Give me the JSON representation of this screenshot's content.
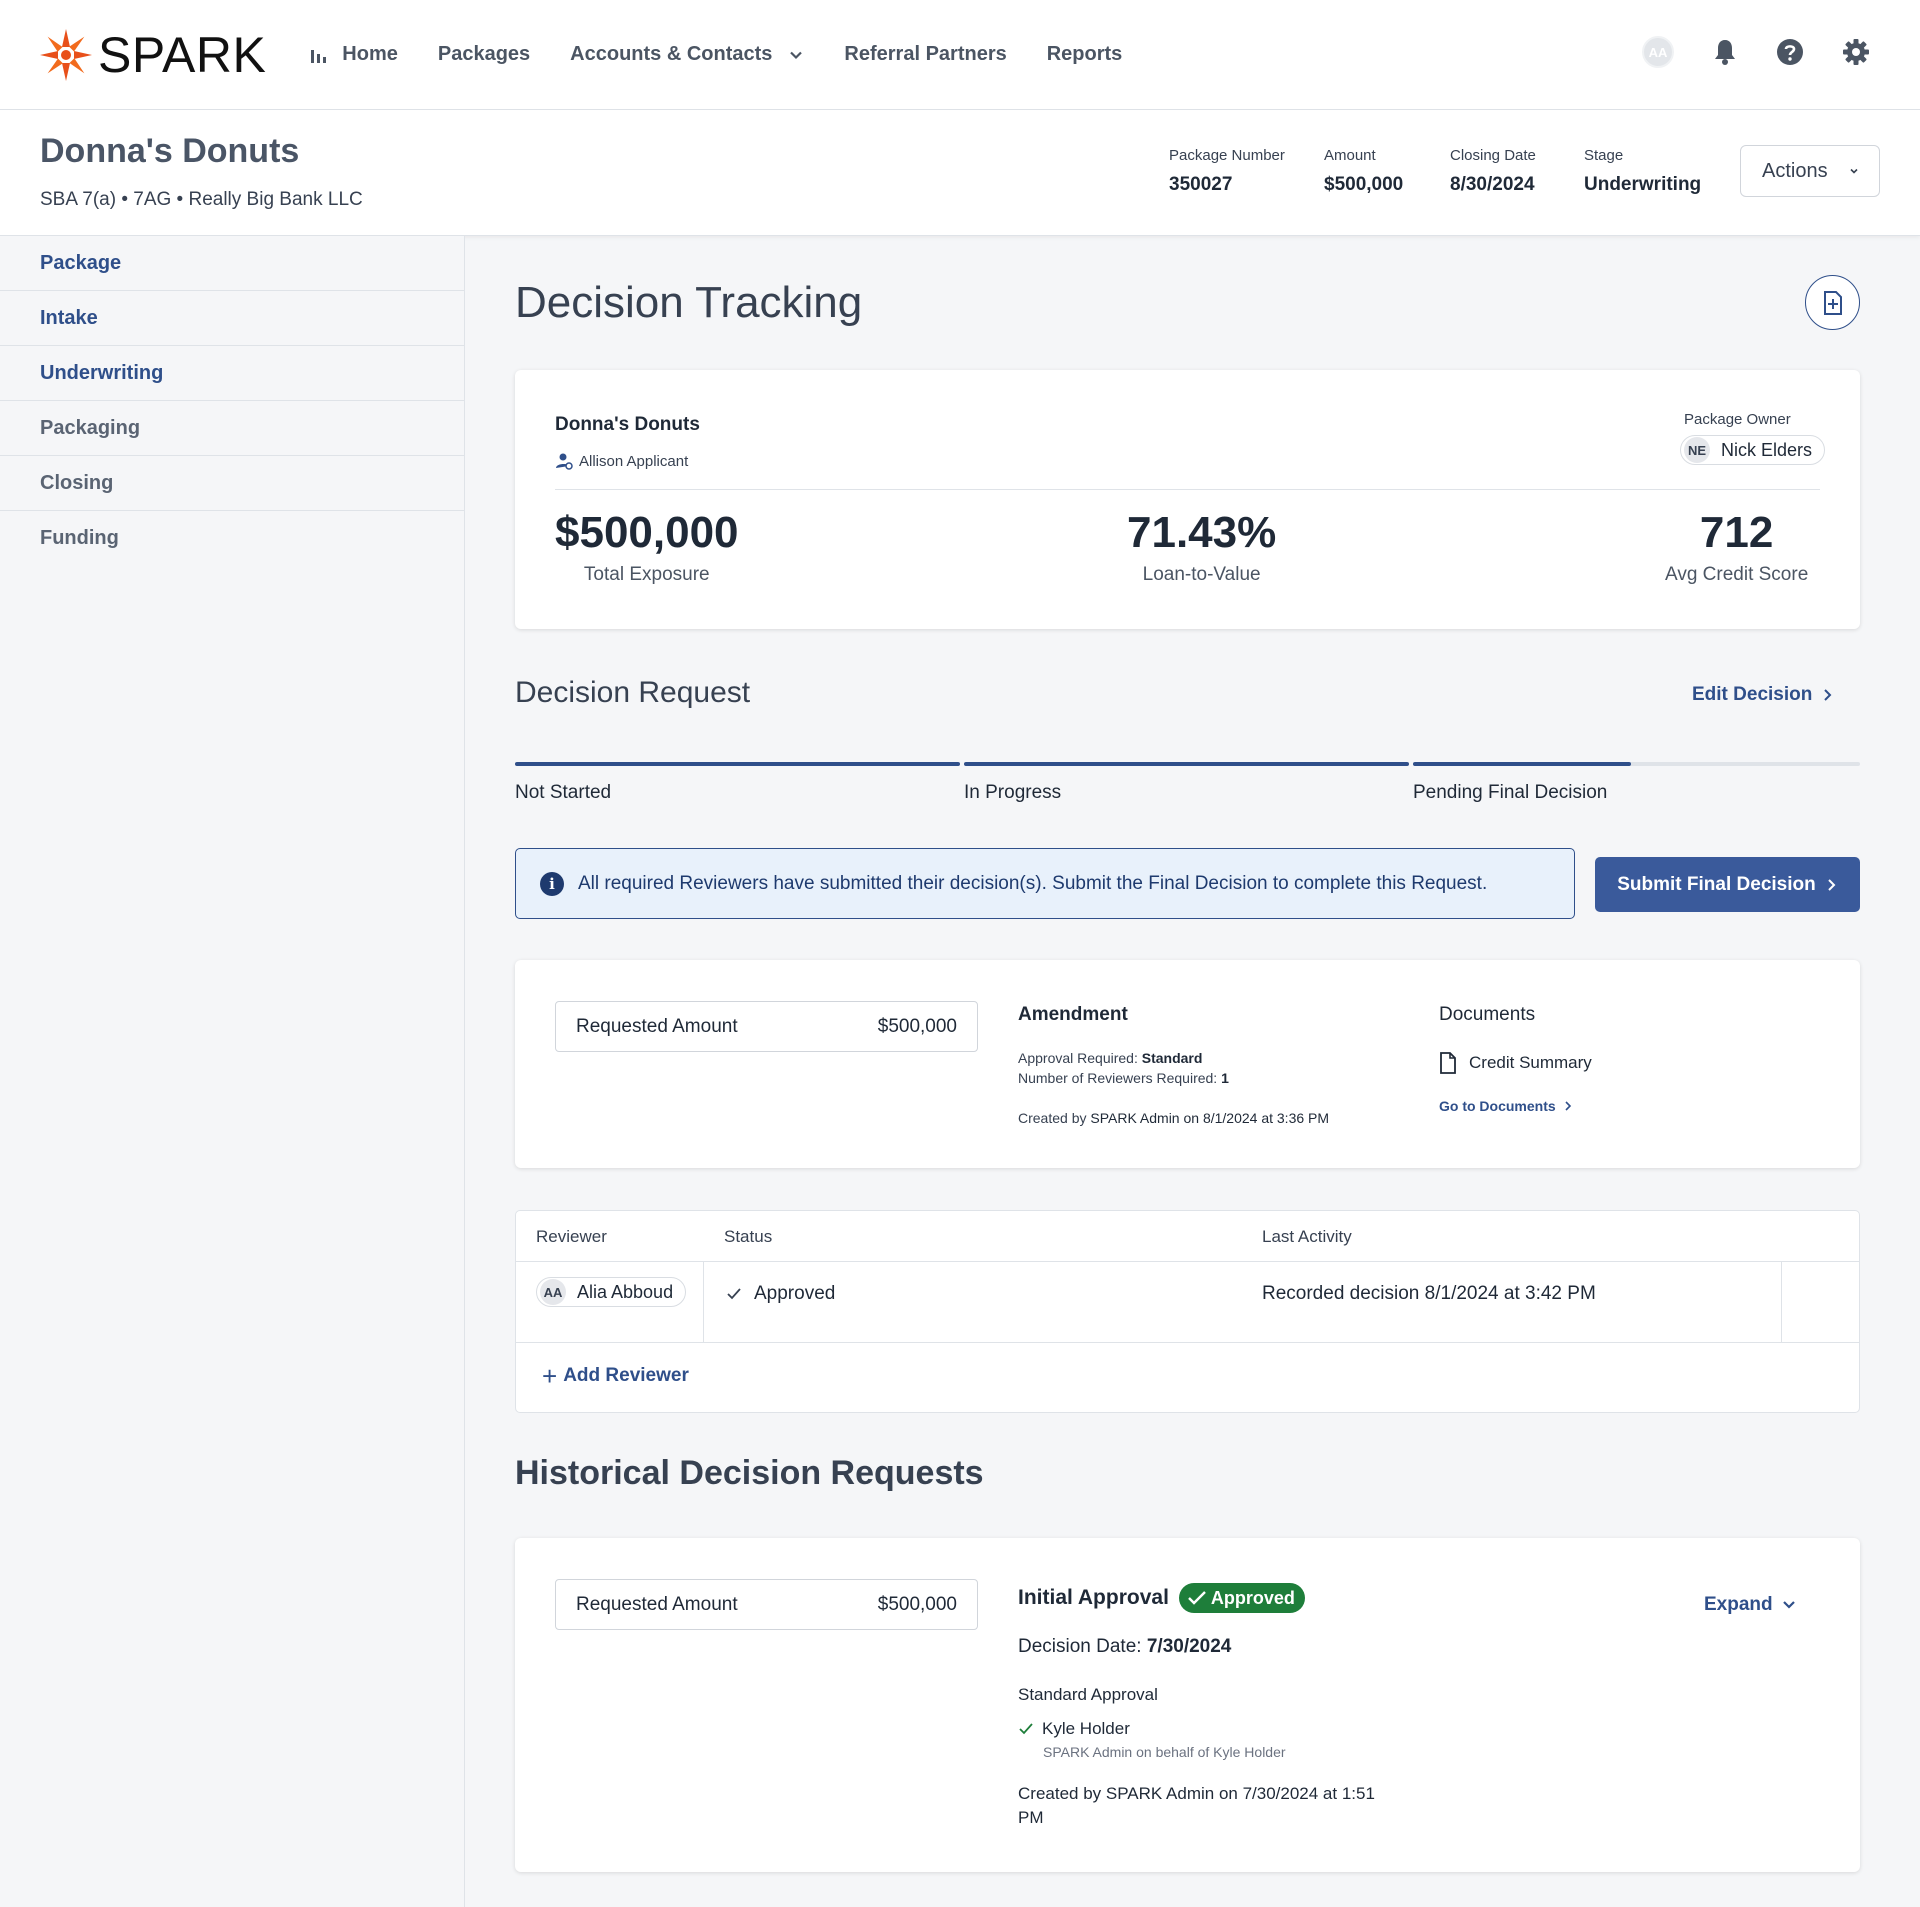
{
  "app": {
    "logo_text": "SPARK",
    "colors": {
      "brand_orange": "#e8501a",
      "primary_blue": "#2f4f8a",
      "approved_green": "#1e7e3a"
    }
  },
  "nav": {
    "items": [
      {
        "label": "Home",
        "icon": "bar-chart-icon"
      },
      {
        "label": "Packages"
      },
      {
        "label": "Accounts & Contacts",
        "icon": "chevron-down-icon"
      },
      {
        "label": "Referral Partners"
      },
      {
        "label": "Reports"
      }
    ],
    "user_initials": "AA",
    "icons": [
      "bell-icon",
      "help-icon",
      "gear-icon"
    ]
  },
  "package": {
    "name": "Donna's Donuts",
    "subtitle": "SBA 7(a) • 7AG • Really Big Bank LLC",
    "meta": {
      "number_label": "Package Number",
      "number_value": "350027",
      "amount_label": "Amount",
      "amount_value": "$500,000",
      "closing_label": "Closing Date",
      "closing_value": "8/30/2024",
      "stage_label": "Stage",
      "stage_value": "Underwriting"
    },
    "actions_label": "Actions"
  },
  "sidebar": {
    "items": [
      {
        "label": "Package"
      },
      {
        "label": "Intake"
      },
      {
        "label": "Underwriting"
      },
      {
        "label": "Packaging"
      },
      {
        "label": "Closing"
      },
      {
        "label": "Funding"
      }
    ]
  },
  "main": {
    "title": "Decision Tracking",
    "summary": {
      "name": "Donna's Donuts",
      "applicant": "Allison Applicant",
      "owner_label": "Package Owner",
      "owner_initials": "NE",
      "owner_name": "Nick Elders",
      "stats": [
        {
          "value": "$500,000",
          "caption": "Total Exposure"
        },
        {
          "value": "71.43%",
          "caption": "Loan-to-Value"
        },
        {
          "value": "712",
          "caption": "Avg Credit Score"
        }
      ]
    },
    "decision_request": {
      "title": "Decision Request",
      "edit_label": "Edit Decision",
      "steps": [
        "Not Started",
        "In Progress",
        "Pending Final Decision"
      ],
      "progress_fraction": 0.83,
      "banner_text": "All required Reviewers have submitted their decision(s). Submit the Final Decision to complete this Request.",
      "submit_label": "Submit Final Decision",
      "requested_amount_label": "Requested Amount",
      "requested_amount_value": "$500,000",
      "amendment_title": "Amendment",
      "approval_required_label": "Approval Required:",
      "approval_required_value": "Standard",
      "reviewers_required_label": "Number of Reviewers Required:",
      "reviewers_required_value": "1",
      "created_prefix": "Created by",
      "created_value": "SPARK Admin on 8/1/2024 at 3:36 PM",
      "documents_title": "Documents",
      "documents": [
        "Credit Summary"
      ],
      "goto_documents_label": "Go to Documents"
    },
    "reviewers": {
      "headers": [
        "Reviewer",
        "Status",
        "Last Activity"
      ],
      "rows": [
        {
          "initials": "AA",
          "name": "Alia Abboud",
          "status": "Approved",
          "last_activity": "Recorded decision 8/1/2024 at 3:42 PM"
        }
      ],
      "add_label": "Add Reviewer"
    },
    "history": {
      "title": "Historical Decision Requests",
      "requested_amount_label": "Requested Amount",
      "requested_amount_value": "$500,000",
      "item_title": "Initial Approval",
      "badge": "Approved",
      "decision_date_label": "Decision Date:",
      "decision_date_value": "7/30/2024",
      "approval_type": "Standard Approval",
      "reviewer": "Kyle Holder",
      "behalf": "SPARK Admin on behalf of Kyle Holder",
      "created": "Created by SPARK Admin on 7/30/2024 at 1:51 PM",
      "expand_label": "Expand"
    }
  }
}
